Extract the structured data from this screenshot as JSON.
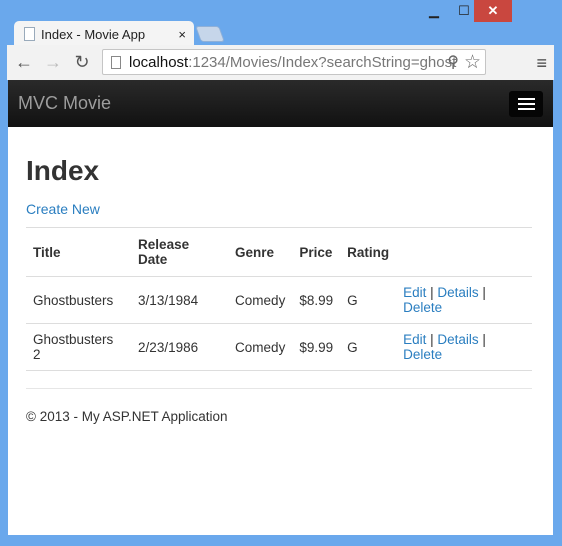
{
  "window": {
    "minimize": "▁",
    "maximize": "☐",
    "close": "✕"
  },
  "tab": {
    "title": "Index - Movie App",
    "close": "×"
  },
  "address": {
    "host": "localhost",
    "rest": ":1234/Movies/Index?searchString=ghost"
  },
  "navbar": {
    "brand": "MVC Movie"
  },
  "page": {
    "title": "Index",
    "create_link": "Create New"
  },
  "table": {
    "headers": [
      "Title",
      "Release Date",
      "Genre",
      "Price",
      "Rating",
      ""
    ],
    "rows": [
      {
        "title": "Ghostbusters",
        "date": "3/13/1984",
        "genre": "Comedy",
        "price": "$8.99",
        "rating": "G"
      },
      {
        "title": "Ghostbusters 2",
        "date": "2/23/1986",
        "genre": "Comedy",
        "price": "$9.99",
        "rating": "G"
      }
    ],
    "actions": {
      "edit": "Edit",
      "details": "Details",
      "delete": "Delete",
      "sep": " | "
    }
  },
  "footer": "© 2013 - My ASP.NET Application",
  "icons": {
    "back": "←",
    "forward": "→",
    "reload": "↻",
    "zoom": "⚲",
    "star": "☆",
    "menu": "≡"
  }
}
